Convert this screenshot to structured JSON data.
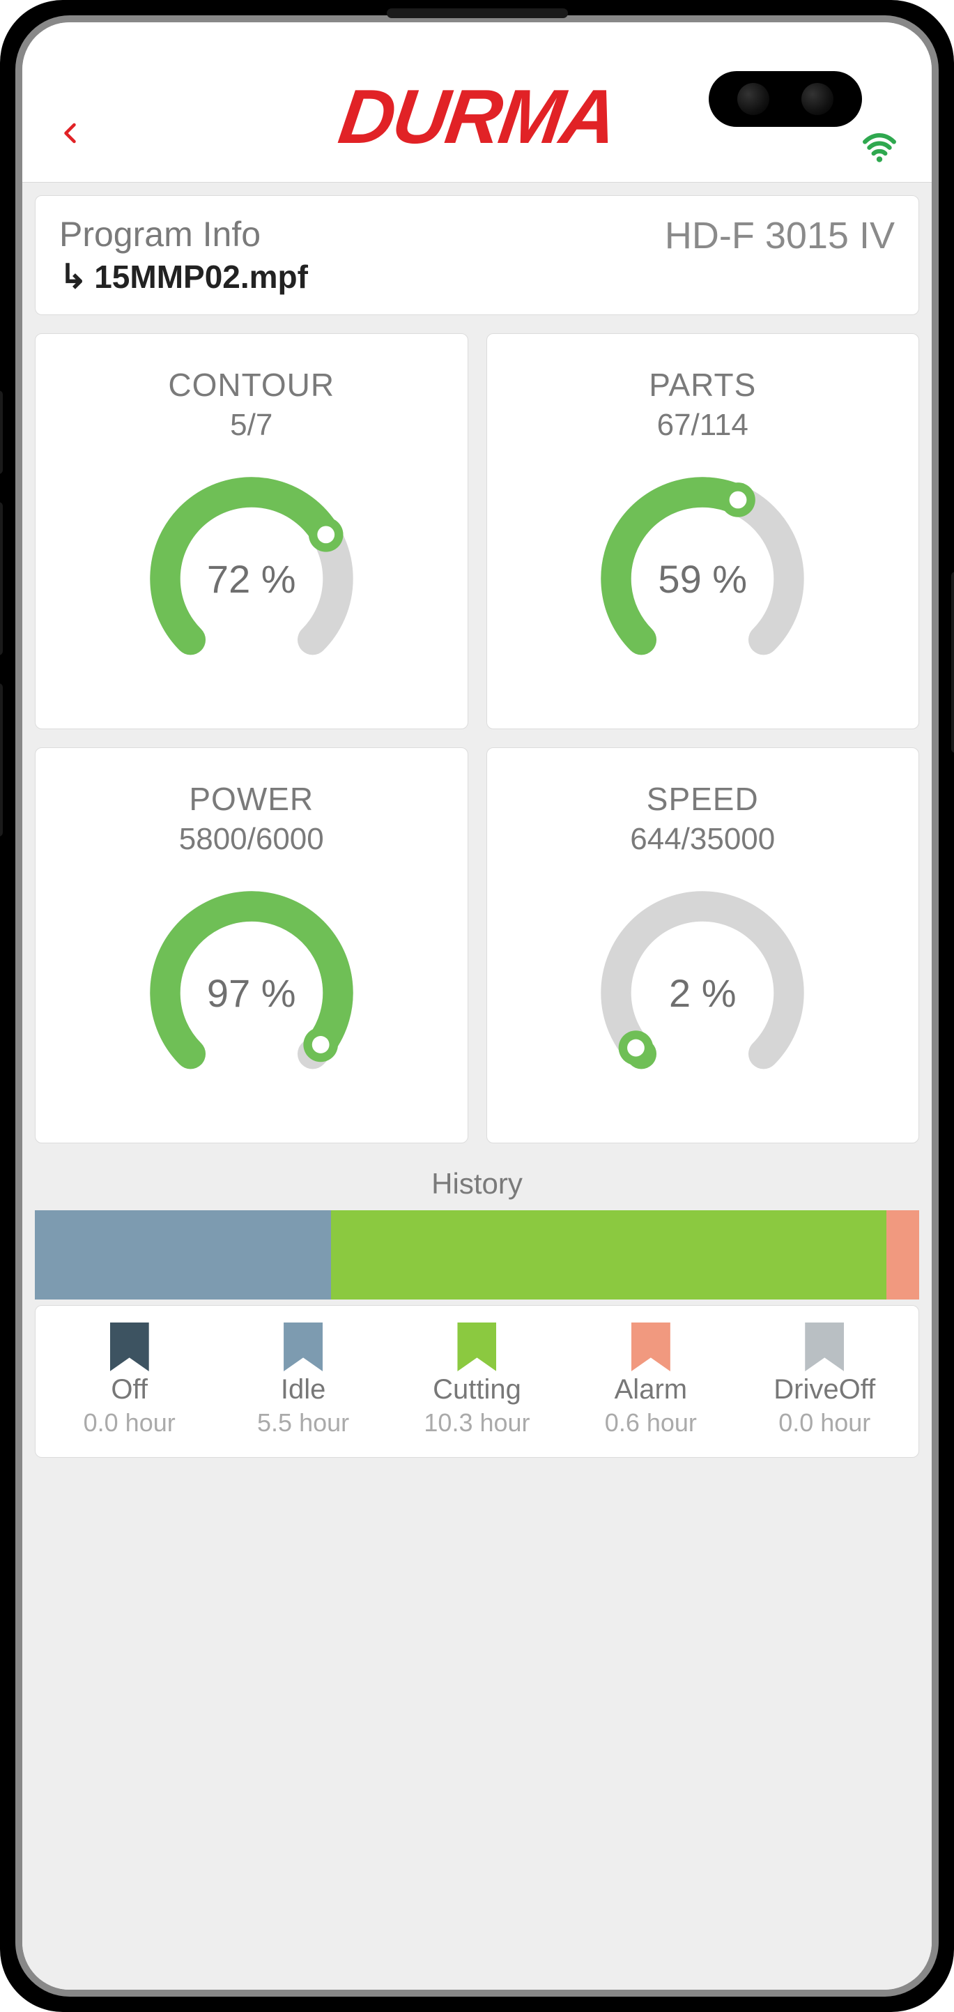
{
  "brand": "DURMA",
  "header": {
    "program_info_label": "Program Info",
    "program_file": "15MMP02.mpf",
    "model": "HD-F 3015 IV"
  },
  "gauges": {
    "contour": {
      "title": "CONTOUR",
      "sub": "5/7",
      "percent_label": "72 %",
      "percent": 72
    },
    "parts": {
      "title": "PARTS",
      "sub": "67/114",
      "percent_label": "59 %",
      "percent": 59
    },
    "power": {
      "title": "POWER",
      "sub": "5800/6000",
      "percent_label": "97 %",
      "percent": 97
    },
    "speed": {
      "title": "SPEED",
      "sub": "644/35000",
      "percent_label": "2 %",
      "percent": 2
    }
  },
  "history": {
    "title": "History",
    "segments": {
      "idle_pct": 33.5,
      "cutting_pct": 62.8,
      "alarm_pct": 3.7
    },
    "legend": {
      "off": {
        "label": "Off",
        "hours": "0.0 hour"
      },
      "idle": {
        "label": "Idle",
        "hours": "5.5 hour"
      },
      "cutting": {
        "label": "Cutting",
        "hours": "10.3 hour"
      },
      "alarm": {
        "label": "Alarm",
        "hours": "0.6 hour"
      },
      "driveoff": {
        "label": "DriveOff",
        "hours": "0.0 hour"
      }
    }
  },
  "chart_data": [
    {
      "type": "gauge",
      "title": "CONTOUR",
      "value": 5,
      "max": 7,
      "percent": 72
    },
    {
      "type": "gauge",
      "title": "PARTS",
      "value": 67,
      "max": 114,
      "percent": 59
    },
    {
      "type": "gauge",
      "title": "POWER",
      "value": 5800,
      "max": 6000,
      "percent": 97
    },
    {
      "type": "gauge",
      "title": "SPEED",
      "value": 644,
      "max": 35000,
      "percent": 2
    },
    {
      "type": "bar",
      "title": "History",
      "categories": [
        "Off",
        "Idle",
        "Cutting",
        "Alarm",
        "DriveOff"
      ],
      "values": [
        0.0,
        5.5,
        10.3,
        0.6,
        0.0
      ],
      "ylabel": "hours"
    }
  ]
}
